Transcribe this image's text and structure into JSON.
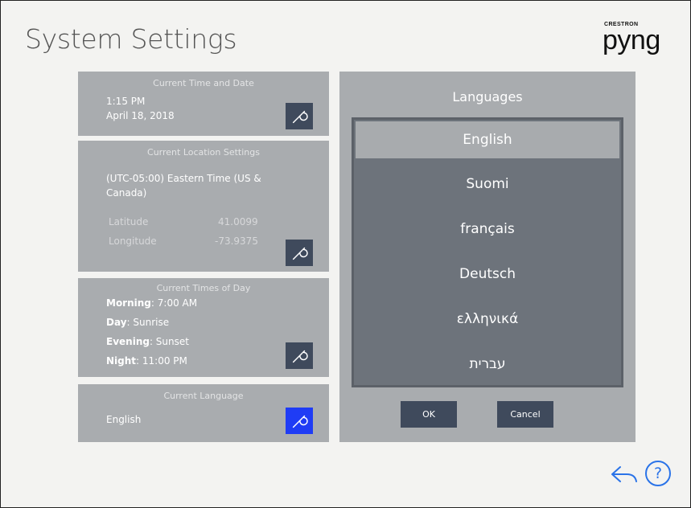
{
  "page": {
    "title": "System Settings"
  },
  "logo": {
    "small": "CRESTRON",
    "big": "pyng"
  },
  "time_card": {
    "heading": "Current Time and Date",
    "time": "1:15 PM",
    "date": "April 18, 2018"
  },
  "location_card": {
    "heading": "Current Location Settings",
    "timezone_line1": "(UTC-05:00) Eastern Time (US &",
    "timezone_line2": "Canada)",
    "latitude_label": "Latitude",
    "latitude_value": "41.0099",
    "longitude_label": "Longitude",
    "longitude_value": "-73.9375"
  },
  "times_card": {
    "heading": "Current Times of Day",
    "rows": [
      {
        "label": "Morning",
        "value": ": 7:00 AM"
      },
      {
        "label": "Day",
        "value": ": Sunrise"
      },
      {
        "label": "Evening",
        "value": ": Sunset"
      },
      {
        "label": "Night",
        "value": ": 11:00 PM"
      }
    ]
  },
  "language_card": {
    "heading": "Current Language",
    "value": "English"
  },
  "languages": {
    "title": "Languages",
    "items": [
      "English",
      "Suomi",
      "français",
      "Deutsch",
      "ελληνικά",
      "עברית"
    ],
    "selected_index": 0,
    "ok_label": "OK",
    "cancel_label": "Cancel"
  },
  "colors": {
    "card_bg": "#a9acaf",
    "button_bg": "#3f4a5c",
    "active_button": "#1f3cf5",
    "help_blue": "#2a73e8"
  },
  "icons": {
    "edit": "wrench-icon",
    "back": "back-arrow-icon",
    "help": "help-icon"
  }
}
